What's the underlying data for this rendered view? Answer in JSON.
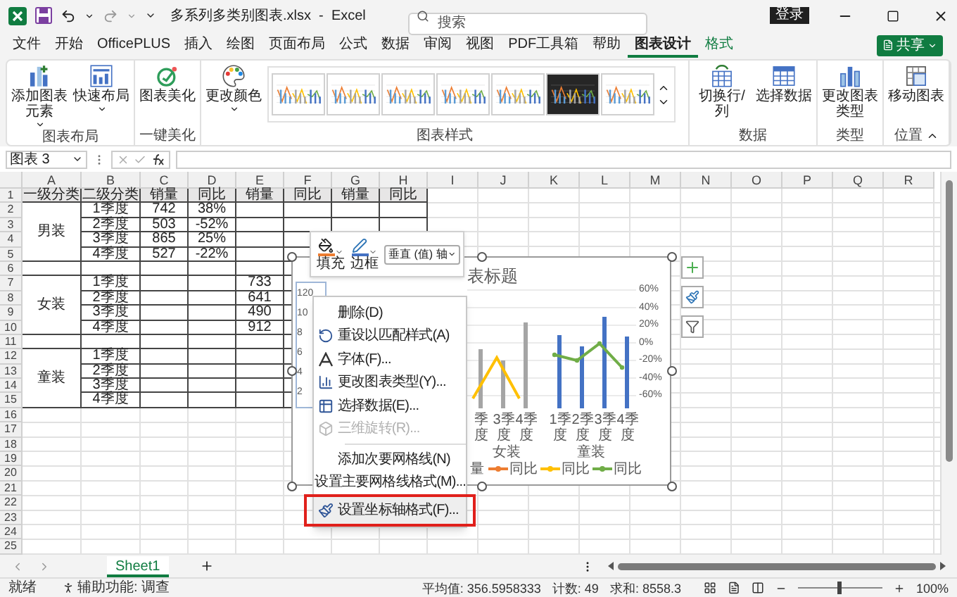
{
  "window": {
    "title": "多系列多类别图表.xlsx  -  Excel",
    "search_placeholder": "搜索",
    "sign_in": "登录"
  },
  "menu_tabs": [
    {
      "label": "文件",
      "selected": false,
      "contextual": false
    },
    {
      "label": "开始",
      "selected": false,
      "contextual": false
    },
    {
      "label": "OfficePLUS",
      "selected": false,
      "contextual": false
    },
    {
      "label": "插入",
      "selected": false,
      "contextual": false
    },
    {
      "label": "绘图",
      "selected": false,
      "contextual": false
    },
    {
      "label": "页面布局",
      "selected": false,
      "contextual": false
    },
    {
      "label": "公式",
      "selected": false,
      "contextual": false
    },
    {
      "label": "数据",
      "selected": false,
      "contextual": false
    },
    {
      "label": "审阅",
      "selected": false,
      "contextual": false
    },
    {
      "label": "视图",
      "selected": false,
      "contextual": false
    },
    {
      "label": "PDF工具箱",
      "selected": false,
      "contextual": false
    },
    {
      "label": "帮助",
      "selected": false,
      "contextual": false
    },
    {
      "label": "图表设计",
      "selected": true,
      "contextual": true
    },
    {
      "label": "格式",
      "selected": false,
      "contextual": true
    }
  ],
  "share_button": "共享",
  "ribbon": {
    "groups": [
      {
        "label": "图表布局",
        "kind": "buttons",
        "buttons": [
          {
            "label": "添加图表元素",
            "dropdown": true
          },
          {
            "label": "快速布局",
            "dropdown": true
          }
        ]
      },
      {
        "label": "一键美化",
        "kind": "buttons",
        "buttons": [
          {
            "label": "图表美化",
            "dropdown": false
          }
        ]
      },
      {
        "label": "图表样式",
        "kind": "gallery",
        "buttons": [
          {
            "label": "更改颜色",
            "dropdown": true
          }
        ],
        "styles": [
          {
            "kind": "light"
          },
          {
            "kind": "light"
          },
          {
            "kind": "light"
          },
          {
            "kind": "light"
          },
          {
            "kind": "light"
          },
          {
            "kind": "dark"
          },
          {
            "kind": "light"
          }
        ]
      },
      {
        "label": "数据",
        "kind": "buttons",
        "buttons": [
          {
            "label": "切换行/列",
            "dropdown": false
          },
          {
            "label": "选择数据",
            "dropdown": false
          }
        ]
      },
      {
        "label": "类型",
        "kind": "buttons",
        "buttons": [
          {
            "label": "更改图表类型",
            "dropdown": false
          }
        ]
      },
      {
        "label": "位置",
        "kind": "buttons",
        "buttons": [
          {
            "label": "移动图表",
            "dropdown": false
          }
        ]
      }
    ]
  },
  "formula_bar": {
    "name_box": "图表 3"
  },
  "sheet": {
    "columns": [
      "A",
      "B",
      "C",
      "D",
      "E",
      "F",
      "G",
      "H",
      "I",
      "J",
      "K",
      "L",
      "M",
      "N",
      "O",
      "P",
      "Q",
      "R"
    ],
    "row_numbers": [
      "1",
      "2",
      "3",
      "4",
      "5",
      "6",
      "7",
      "8",
      "9",
      "10",
      "11",
      "12",
      "13",
      "14",
      "15",
      "16",
      "17",
      "18",
      "19",
      "20",
      "21",
      "22",
      "23",
      "24",
      "25"
    ],
    "header": [
      "一级分类",
      "二级分类",
      "销量",
      "同比",
      "销量",
      "同比",
      "销量",
      "同比"
    ],
    "groups": [
      {
        "label": "男装",
        "rows": [
          {
            "cells": [
              "1季度",
              "742",
              "38%",
              "",
              "",
              "",
              ""
            ]
          },
          {
            "cells": [
              "2季度",
              "503",
              "-52%",
              "",
              "",
              "",
              ""
            ]
          },
          {
            "cells": [
              "3季度",
              "865",
              "25%",
              "",
              "",
              "",
              ""
            ]
          },
          {
            "cells": [
              "4季度",
              "527",
              "-22%",
              "",
              "",
              "",
              ""
            ]
          }
        ]
      },
      {
        "label": "女装",
        "rows": [
          {
            "cells": [
              "1季度",
              "",
              "",
              "733",
              "",
              "",
              ""
            ]
          },
          {
            "cells": [
              "2季度",
              "",
              "",
              "641",
              "",
              "",
              ""
            ]
          },
          {
            "cells": [
              "3季度",
              "",
              "",
              "490",
              "",
              "",
              ""
            ]
          },
          {
            "cells": [
              "4季度",
              "",
              "",
              "912",
              "",
              "",
              ""
            ]
          }
        ]
      },
      {
        "label": "童装",
        "rows": [
          {
            "cells": [
              "1季度",
              "",
              "",
              "",
              "",
              "",
              ""
            ]
          },
          {
            "cells": [
              "2季度",
              "",
              "",
              "",
              "",
              "",
              ""
            ]
          },
          {
            "cells": [
              "3季度",
              "",
              "",
              "",
              "",
              "",
              ""
            ]
          },
          {
            "cells": [
              "4季度",
              "",
              "",
              "",
              "",
              "",
              ""
            ]
          }
        ]
      }
    ]
  },
  "chart": {
    "title": "表标题",
    "left_axis": [
      "120",
      "10",
      "8",
      "6",
      "4",
      "2"
    ],
    "right_axis": [
      "60%",
      "40%",
      "20%",
      "0%",
      "-20%",
      "-40%",
      "-60%"
    ],
    "categories": [
      "季度",
      "3季度",
      "4季度",
      "1季度",
      "2季度",
      "3季度",
      "4季度"
    ],
    "group_labels": [
      "女装",
      "童装"
    ],
    "legend_lead": "量",
    "legend": [
      {
        "label": "同比",
        "color": "#ed7d31"
      },
      {
        "label": "同比",
        "color": "#ffc000"
      },
      {
        "label": "同比",
        "color": "#70ad47"
      }
    ]
  },
  "mini_toolbar": {
    "fill": "填充",
    "border": "边框",
    "element": "垂直 (值) 轴"
  },
  "context_menu": [
    {
      "kind": "item",
      "label": "删除(D)",
      "disabled": false,
      "highlighted": false
    },
    {
      "kind": "item",
      "label": "重设以匹配样式(A)",
      "disabled": false,
      "highlighted": false
    },
    {
      "kind": "item",
      "label": "字体(F)...",
      "disabled": false,
      "highlighted": false
    },
    {
      "kind": "item",
      "label": "更改图表类型(Y)...",
      "disabled": false,
      "highlighted": false
    },
    {
      "kind": "item",
      "label": "选择数据(E)...",
      "disabled": false,
      "highlighted": false
    },
    {
      "kind": "item",
      "label": "三维旋转(R)...",
      "disabled": true,
      "highlighted": false
    },
    {
      "kind": "separator"
    },
    {
      "kind": "item",
      "label": "添加次要网格线(N)",
      "disabled": false,
      "highlighted": false
    },
    {
      "kind": "item",
      "label": "设置主要网格线格式(M)...",
      "disabled": false,
      "highlighted": false
    },
    {
      "kind": "item",
      "label": "设置坐标轴格式(F)...",
      "disabled": false,
      "highlighted": true
    }
  ],
  "sheet_tabs": [
    {
      "label": "Sheet1",
      "selected": true
    }
  ],
  "status_bar": {
    "ready": "就绪",
    "accessibility": "辅助功能: 调查",
    "average": "平均值: 356.5958333",
    "count": "计数: 49",
    "sum": "求和: 8558.3",
    "zoom": "100%",
    "zoom_slider": {
      "level": 0.5
    }
  }
}
